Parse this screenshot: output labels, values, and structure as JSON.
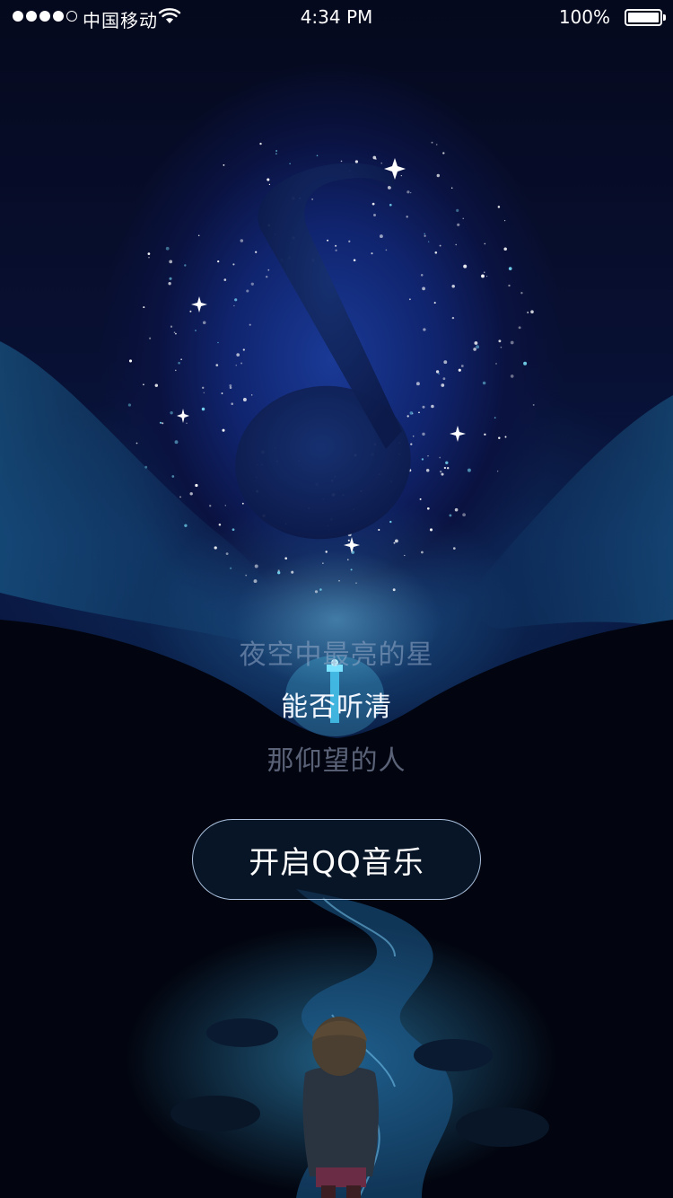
{
  "status_bar": {
    "carrier": "中国移动",
    "time": "4:34 PM",
    "battery_percent": "100%",
    "signal_bars_filled": 4,
    "signal_bars_total": 5,
    "wifi_icon": "wifi-icon",
    "battery_level": 1.0
  },
  "artwork": {
    "icon": "music-note-icon",
    "description_icons": [
      "sparkle-icon",
      "lighthouse-icon",
      "river-icon",
      "child-figure-icon"
    ]
  },
  "lyrics": {
    "line1": "夜空中最亮的星",
    "line2": "能否听清",
    "line3": "那仰望的人"
  },
  "open_button": {
    "label": "开启QQ音乐"
  },
  "colors": {
    "sky_top": "#05091d",
    "galaxy_blue": "#1a3a96",
    "glow_cyan": "#6ec8f0",
    "ground": "#02040d"
  }
}
